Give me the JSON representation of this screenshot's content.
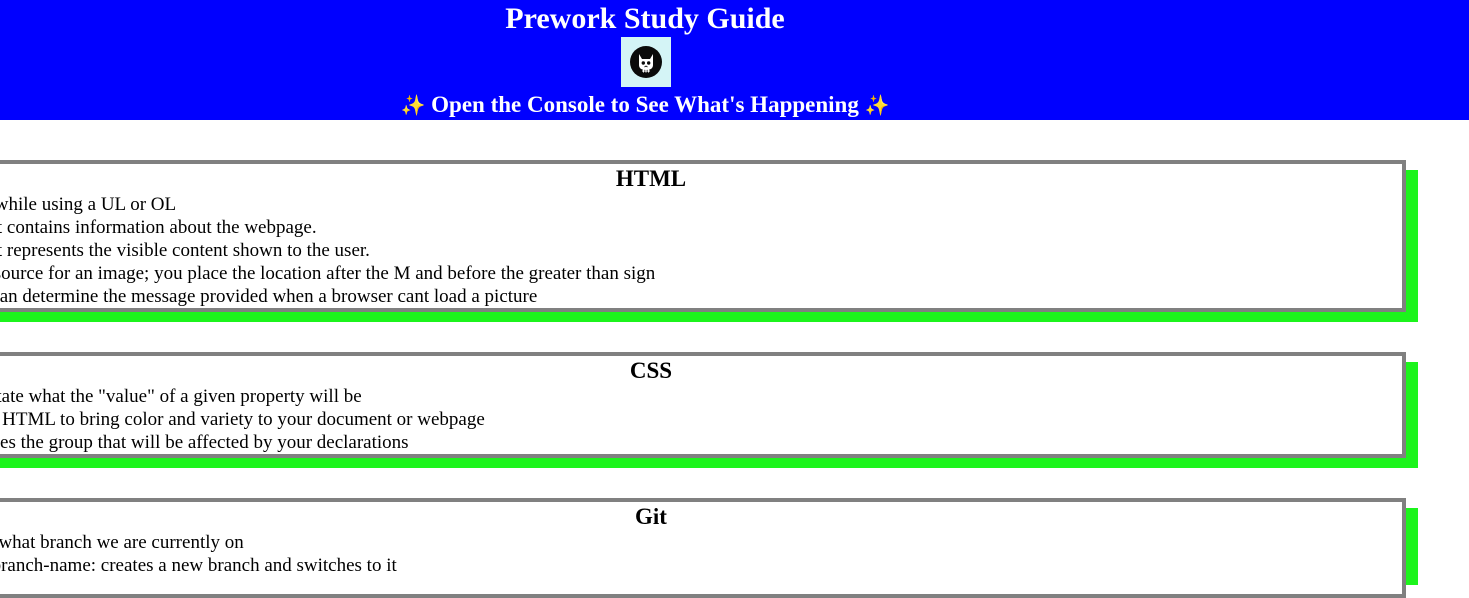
{
  "header": {
    "title": "Prework Study Guide",
    "logo_icon": "cat-skull-icon",
    "subtitle": "Open the Console to See What's Happening",
    "sparkle_left": "✨",
    "sparkle_right": "✨",
    "background_color": "#0000ff",
    "text_color": "#ffffff"
  },
  "sections": [
    {
      "title": "HTML",
      "items": [
        "use LI while using a UL or OL",
        "element contains information about the webpage.",
        "element represents the visible content shown to the user.",
        "ding a source for an image; you place the location after the M and before the greater than sign",
        "T you can determine the message provided when a browser cant load a picture"
      ]
    },
    {
      "title": "CSS",
      "items": [
        "ons dictate what the \"value\" of a given property will be",
        "ks with HTML to bring color and variety to your document or webpage",
        "etermines the group that will be affected by your declarations"
      ]
    },
    {
      "title": "Git",
      "items": [
        "checks what branch we are currently on",
        "out -b branch-name: creates a new branch and switches to it"
      ]
    }
  ],
  "colors": {
    "card_border": "#808080",
    "card_shadow": "#1cf41c"
  }
}
